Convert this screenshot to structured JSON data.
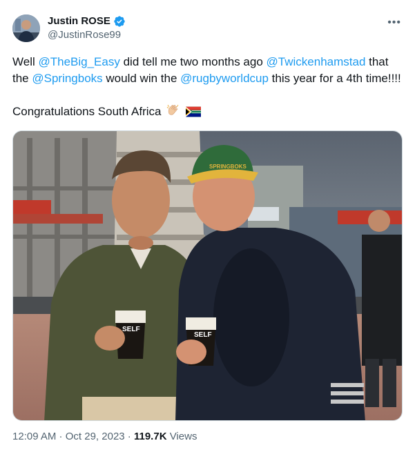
{
  "author": {
    "display_name": "Justin ROSE",
    "handle": "@JustinRose99",
    "verified": true,
    "verified_color": "#1d9bf0"
  },
  "tweet": {
    "text_prefix": "Well ",
    "mention_1": "@TheBig_Easy",
    "text_2": " did tell me two months ago ",
    "mention_2": "@Twickenhamstad",
    "text_3": " that the ",
    "mention_3": "@Springboks",
    "text_4": " would win the ",
    "mention_4": "@rugbyworldcup",
    "text_5": " this year for a 4th time!!!!",
    "line_2": "Congratulations South Africa",
    "emojis": [
      "clapping-hands-icon",
      "south-africa-flag-icon"
    ]
  },
  "photo": {
    "cap_text": "SPRINGBOKS",
    "cup_text_1": "SELF",
    "cup_text_2": "SELF"
  },
  "meta": {
    "time": "12:09 AM",
    "separator_1": " · ",
    "date": "Oct 29, 2023",
    "separator_2": " · ",
    "views_count": "119.7K",
    "views_label": " Views"
  },
  "colors": {
    "link": "#1d9bf0",
    "secondary_text": "#536471",
    "primary_text": "#0f1419"
  }
}
